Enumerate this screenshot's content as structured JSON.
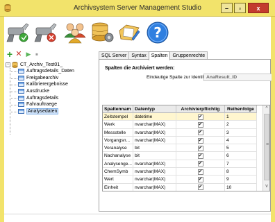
{
  "window": {
    "title": "Archivsystem Server Management Studio",
    "min_glyph": "–",
    "max_glyph": "▫",
    "close_glyph": "x"
  },
  "toolbar_big": [
    {
      "name": "connect-server-icon"
    },
    {
      "name": "disconnect-server-icon"
    },
    {
      "name": "users-icon"
    },
    {
      "name": "database-settings-icon"
    },
    {
      "name": "edit-document-icon"
    },
    {
      "name": "help-icon"
    }
  ],
  "toolbar_small": {
    "add_glyph": "+",
    "delete_glyph": "✕",
    "run_glyph": "▶",
    "save_glyph": "▪"
  },
  "tree": {
    "root_label": "CT_Archiv_Test01_",
    "expander": "−",
    "items": [
      "Auftragsdetails_Daten",
      "Freigabearchiv",
      "Kalibrierergebnisse",
      "Ausdrucke",
      "Auftragsdetails",
      "Fahrauftraege",
      "Analysedaten"
    ],
    "selected_index": 6
  },
  "tabs": [
    "SQL Server",
    "Syntax",
    "Spalten",
    "Gruppenrechte"
  ],
  "active_tab": "Spalten",
  "panel": {
    "section_title": "Spalten die Archiviert werden:",
    "ident_label": "Eindeutige Spalte zur Identifikation:",
    "ident_value": "AnaResult_ID"
  },
  "grid": {
    "headers": [
      "Spaltennam",
      "Datentyp",
      "Archivierpflichtig",
      "Reihenfolge"
    ],
    "rows": [
      {
        "name": "Zeitstempel",
        "type": "datetime",
        "checked": true,
        "order": "1"
      },
      {
        "name": "Werk",
        "type": "nvarchar(MAX)",
        "checked": true,
        "order": "2"
      },
      {
        "name": "Messstelle",
        "type": "nvarchar(MAX)",
        "checked": true,
        "order": "3"
      },
      {
        "name": "Vorgangsn...",
        "type": "nvarchar(MAX)",
        "checked": true,
        "order": "4"
      },
      {
        "name": "Voranalyse",
        "type": "bit",
        "checked": true,
        "order": "5"
      },
      {
        "name": "Nachanalyse",
        "type": "bit",
        "checked": true,
        "order": "6"
      },
      {
        "name": "Analysenge...",
        "type": "nvarchar(MAX)",
        "checked": true,
        "order": "7"
      },
      {
        "name": "ChemSymb",
        "type": "nvarchar(MAX)",
        "checked": true,
        "order": "8"
      },
      {
        "name": "Wert",
        "type": "nvarchar(MAX)",
        "checked": true,
        "order": "9"
      },
      {
        "name": "Einheit",
        "type": "nvarchar(MAX)",
        "checked": true,
        "order": "10"
      }
    ],
    "check_glyph": "✔",
    "scroll_up": "^",
    "scroll_down": "v",
    "scroll_grip": "≡"
  },
  "colors": {
    "title_bar": "#f2e36b",
    "close_button": "#c33b2e",
    "selected_row": "#fff6cf",
    "tree_selection": "#cfe3fb"
  }
}
